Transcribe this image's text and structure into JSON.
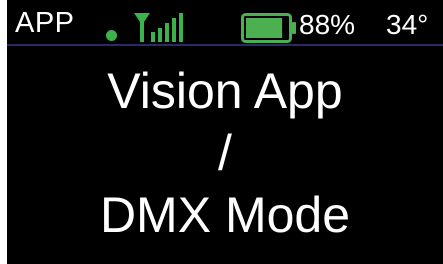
{
  "status_bar": {
    "app_label": "APP",
    "status_dot_color": "#3bb34a",
    "signal_icon": "signal-bars-icon",
    "signal_color": "#3bb34a",
    "signal_strength_bars": 5,
    "battery_icon": "battery-icon",
    "battery_color": "#4caf50",
    "battery_level": 0.88,
    "battery_text": "88%",
    "temperature": "34°"
  },
  "main": {
    "lines": [
      "Vision App",
      "/",
      "DMX Mode"
    ]
  }
}
